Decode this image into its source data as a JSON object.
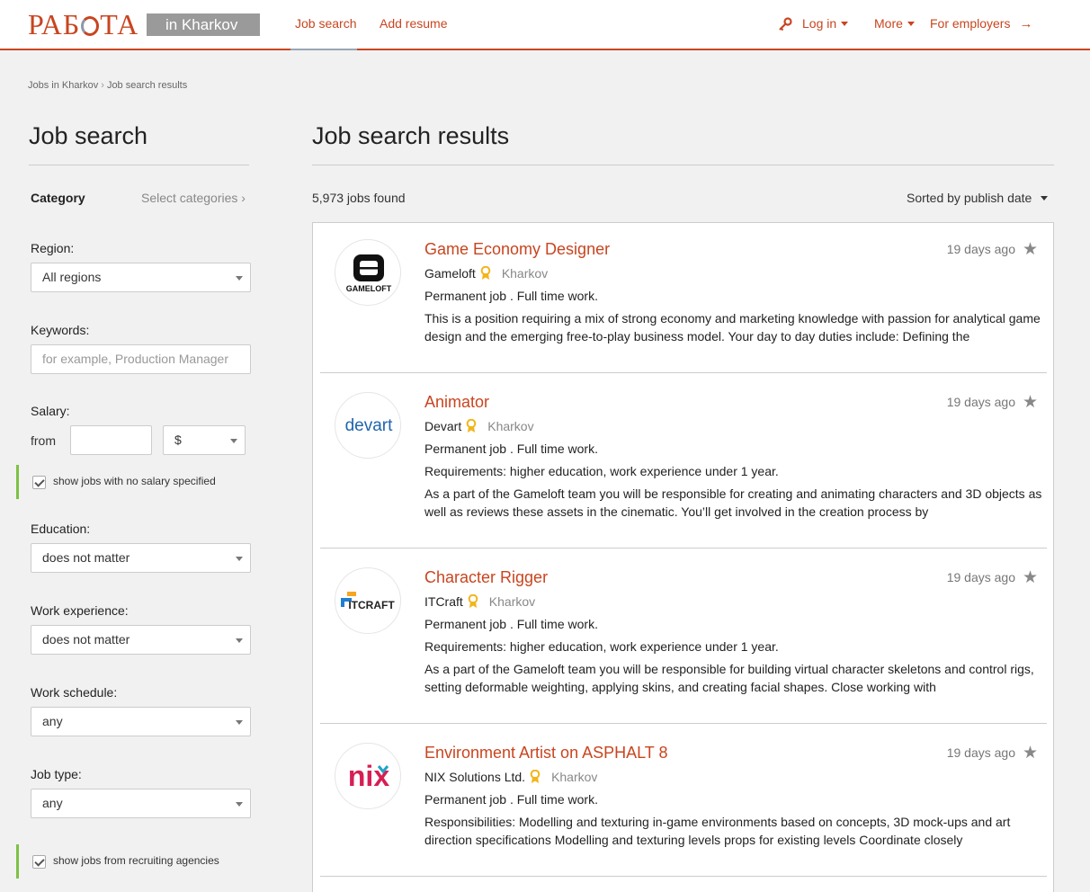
{
  "header": {
    "logo": "РАБОТА",
    "city_badge": "in Kharkov",
    "nav": [
      "Job search",
      "Add resume"
    ],
    "login": "Log in",
    "more": "More",
    "employers": "For employers",
    "accent": "#c9451f"
  },
  "breadcrumb": [
    "Jobs in Kharkov",
    "Job search results"
  ],
  "sidebar": {
    "title": "Job search",
    "category_label": "Category",
    "category_link": "Select categories",
    "region_label": "Region:",
    "region_value": "All regions",
    "keywords_label": "Keywords:",
    "keywords_placeholder": "for example, Production Manager",
    "salary_label": "Salary:",
    "from_label": "from",
    "currency": "$",
    "no_salary_check": "show jobs with no salary specified",
    "education_label": "Education:",
    "education_value": "does not matter",
    "experience_label": "Work experience:",
    "experience_value": "does not matter",
    "schedule_label": "Work schedule:",
    "schedule_value": "any",
    "jobtype_label": "Job type:",
    "jobtype_value": "any",
    "agencies_check": "show jobs from recruiting agencies"
  },
  "main": {
    "title": "Job search results",
    "found": "5,973 jobs found",
    "sort": "Sorted by publish date"
  },
  "jobs": [
    {
      "title": "Game Economy Designer",
      "company": "Gameloft",
      "city": "Kharkov",
      "date": "19 days ago",
      "type": "Permanent job . Full time work.",
      "requirements": "",
      "description": "This is a position requiring a mix of strong economy and marketing knowledge with passion for analytical game design and the emerging free-to-play business model. Your day to day duties include: Defining the",
      "logo": "GAMELOFT"
    },
    {
      "title": "Animator",
      "company": "Devart",
      "city": "Kharkov",
      "date": "19 days ago",
      "type": "Permanent job . Full time work.",
      "requirements": "Requirements: higher  education, work experience under 1 year.",
      "description": "As a part of the Gameloft team you will be responsible for creating and animating characters and 3D objects as well as reviews these assets in the cinematic. You’ll get involved in the creation process by",
      "logo": "devart"
    },
    {
      "title": "Character Rigger",
      "company": "ITCraft",
      "city": "Kharkov",
      "date": "19 days ago",
      "type": "Permanent job . Full time work.",
      "requirements": "Requirements: higher  education, work experience under 1 year.",
      "description": "As a part of the Gameloft team you will be responsible for building virtual character skeletons and control rigs, setting deformable weighting, applying skins, and creating facial shapes. Close working with",
      "logo": "ITCRAFT"
    },
    {
      "title": "Environment Artist on ASPHALT 8",
      "company": "NIX Solutions Ltd.",
      "city": "Kharkov",
      "date": "19 days ago",
      "type": "Permanent job . Full time work.",
      "requirements": "",
      "description": "Responsibilities: Modelling and texturing in-game environments based on concepts, 3D mock-ups and art direction specifications Modelling and texturing levels props for existing levels Coordinate closely",
      "logo": "nix"
    }
  ]
}
